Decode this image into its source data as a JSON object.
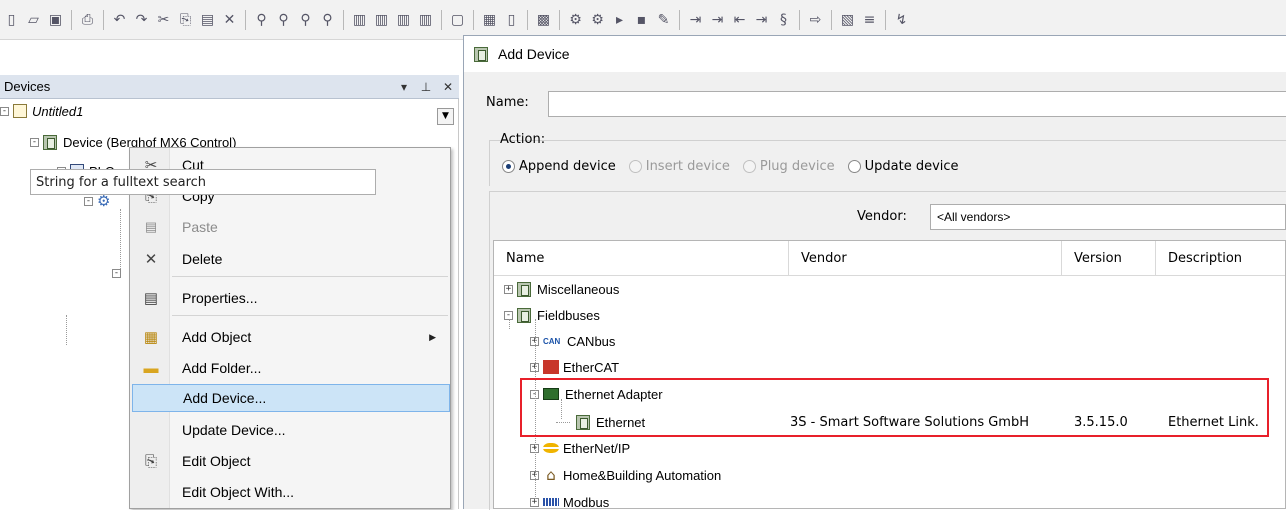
{
  "devices_panel": {
    "title": "Devices",
    "pin_glyph": "▾",
    "dock_glyph": "⊥",
    "close_glyph": "✕",
    "tree": {
      "project": "Untitled1",
      "device": "Device (Berghof MX6 Control)",
      "plc": "PLC"
    }
  },
  "context_menu": {
    "items": [
      {
        "label": "Cut",
        "icon": "scissors-icon",
        "glyph": "✂",
        "disabled": false
      },
      {
        "label": "Copy",
        "icon": "copy-icon",
        "glyph": "⎘",
        "disabled": false
      },
      {
        "label": "Paste",
        "icon": "paste-icon",
        "glyph": "📋",
        "disabled": true
      },
      {
        "label": "Delete",
        "icon": "delete-icon",
        "glyph": "✕",
        "disabled": false
      },
      {
        "label": "Properties...",
        "icon": "properties-icon",
        "glyph": "▤",
        "disabled": false
      },
      {
        "label": "Add Object",
        "icon": "add-object-icon",
        "glyph": "▦",
        "disabled": false,
        "submenu": true
      },
      {
        "label": "Add Folder...",
        "icon": "folder-icon",
        "glyph": "▭",
        "disabled": false
      },
      {
        "label": "Add Device...",
        "icon": "",
        "glyph": "",
        "disabled": false,
        "selected": true
      },
      {
        "label": "Update Device...",
        "icon": "",
        "glyph": "",
        "disabled": false
      },
      {
        "label": "Edit Object",
        "icon": "edit-object-icon",
        "glyph": "⌐",
        "disabled": false
      },
      {
        "label": "Edit Object With...",
        "icon": "",
        "glyph": "",
        "disabled": false
      }
    ]
  },
  "dialog": {
    "title": "Add Device",
    "name_label": "Name:",
    "name_value": "",
    "action_label": "Action:",
    "actions": [
      {
        "label": "Append device",
        "checked": true,
        "disabled": false
      },
      {
        "label": "Insert device",
        "checked": false,
        "disabled": true
      },
      {
        "label": "Plug device",
        "checked": false,
        "disabled": true
      },
      {
        "label": "Update device",
        "checked": false,
        "disabled": false
      }
    ],
    "search_placeholder": "String for a fulltext search",
    "vendor_label": "Vendor:",
    "vendor_value": "<All vendors>",
    "columns": [
      "Name",
      "Vendor",
      "Version",
      "Description"
    ],
    "rows": [
      {
        "name": "Miscellaneous",
        "vendor": "",
        "version": "",
        "description": ""
      },
      {
        "name": "Fieldbuses",
        "vendor": "",
        "version": "",
        "description": ""
      },
      {
        "name": "CANbus",
        "vendor": "",
        "version": "",
        "description": ""
      },
      {
        "name": "EtherCAT",
        "vendor": "",
        "version": "",
        "description": ""
      },
      {
        "name": "Ethernet Adapter",
        "vendor": "",
        "version": "",
        "description": ""
      },
      {
        "name": "Ethernet",
        "vendor": "3S - Smart Software Solutions GmbH",
        "version": "3.5.15.0",
        "description": "Ethernet Link."
      },
      {
        "name": "EtherNet/IP",
        "vendor": "",
        "version": "",
        "description": ""
      },
      {
        "name": "Home&Building Automation",
        "vendor": "",
        "version": "",
        "description": ""
      },
      {
        "name": "Modbus",
        "vendor": "",
        "version": "",
        "description": ""
      }
    ],
    "icon_text": {
      "can": "CAN"
    }
  },
  "colors": {
    "highlight": "#e8202a",
    "selection": "#cce4f7"
  }
}
